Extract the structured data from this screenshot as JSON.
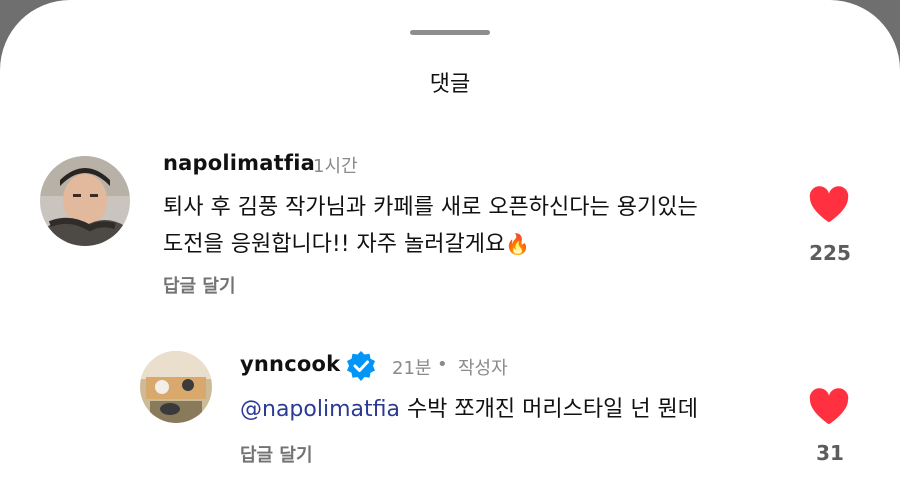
{
  "sheet": {
    "title": "댓글"
  },
  "comments": [
    {
      "username": "napolimatfia",
      "time": "1시간",
      "line1": "퇴사 후 김풍 작가님과 카페를 새로 오픈하신다는 용기있는",
      "line2": "도전을 응원합니다!! 자주 놀러갈게요",
      "emoji": "🔥",
      "reply_label": "답글 달기",
      "likes": "225",
      "liked": true
    }
  ],
  "replies": [
    {
      "username": "ynncook",
      "verified": true,
      "time": "21분",
      "separator": "•",
      "author_badge": "작성자",
      "mention_icon": "@",
      "mention": "napolimatfia",
      "text": " 수박 쪼개진 머리스타일 넌 뭔데",
      "reply_label": "답글 달기",
      "likes": "31",
      "liked": true
    }
  ],
  "colors": {
    "heart": "#ff3040",
    "verified": "#0095f6",
    "mention": "#2b3b95"
  }
}
